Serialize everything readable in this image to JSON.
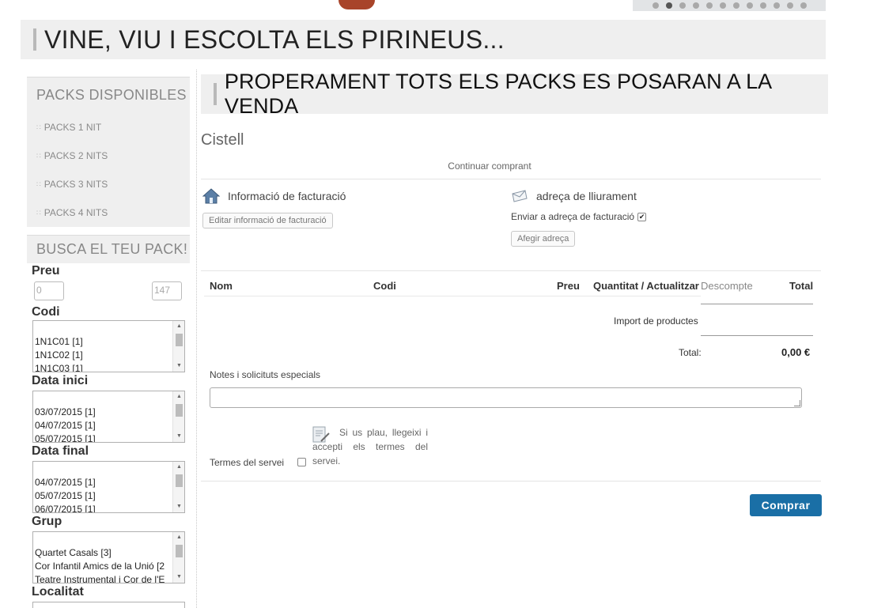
{
  "header": {
    "title": "VINE, VIU I ESCOLTA ELS PIRINEUS...",
    "slider_dot_count": 12,
    "slider_active_index": 1
  },
  "sidebar": {
    "packs_heading": "PACKS DISPONIBLES",
    "packs": [
      "PACKS 1 NIT",
      "PACKS 2 NITS",
      "PACKS 3 NITS",
      "PACKS 4 NITS"
    ],
    "search_heading": "BUSCA EL TEU PACK!",
    "filters": {
      "price": {
        "label": "Preu",
        "min": "0",
        "max": "147"
      },
      "code": {
        "label": "Codi",
        "options": [
          "1N1C01 [1]",
          "1N1C02 [1]",
          "1N1C03 [1]"
        ]
      },
      "start_date": {
        "label": "Data inici",
        "options": [
          "03/07/2015 [1]",
          "04/07/2015 [1]",
          "05/07/2015 [1]"
        ]
      },
      "end_date": {
        "label": "Data final",
        "options": [
          "04/07/2015 [1]",
          "05/07/2015 [1]",
          "06/07/2015 [1]"
        ]
      },
      "group": {
        "label": "Grup",
        "options": [
          "Quartet Casals [3]",
          "Cor Infantil Amics de la Unió [2",
          "Teatre Instrumental i Cor de l'E"
        ]
      },
      "location": {
        "label": "Localitat"
      }
    }
  },
  "main": {
    "banner_title": "PROPERAMENT TOTS ELS PACKS ES POSARAN A LA VENDA",
    "cart_title": "Cistell",
    "continue_link": "Continuar comprant",
    "billing": {
      "heading": "Informació de facturació",
      "edit_button": "Editar informació de facturació"
    },
    "shipping": {
      "heading": "adreça de lliurament",
      "same_as_billing": "Enviar a adreça de facturació",
      "same_as_billing_checked": true,
      "add_button": "Afegir adreça"
    },
    "table": {
      "columns": [
        "Nom",
        "Codi",
        "Preu",
        "Quantitat / Actualitzar",
        "Descompte",
        "Total"
      ],
      "products_import_label": "Import de productes",
      "total_label": "Total:",
      "total_value": "0,00 €"
    },
    "notes_label": "Notes i solicituts especials",
    "terms": {
      "label": "Termes del servei",
      "text": "Si us plau, llegeixi i accepti els termes del servei."
    },
    "buy_button": "Comprar"
  }
}
